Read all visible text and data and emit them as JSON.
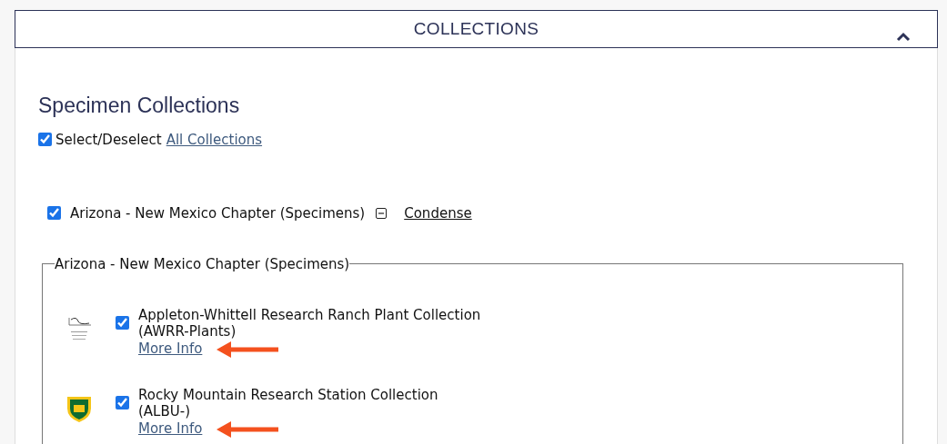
{
  "section": {
    "title": "COLLECTIONS",
    "expanded": true
  },
  "heading": "Specimen Collections",
  "select_all": {
    "checked": true,
    "label": "Select/Deselect",
    "link": "All Collections"
  },
  "chapter": {
    "checked": true,
    "label": "Arizona - New Mexico Chapter (Specimens)",
    "expanded": true,
    "action": "Condense"
  },
  "group": {
    "legend": "Arizona - New Mexico Chapter (Specimens)",
    "collections": [
      {
        "kind": "audubon",
        "checked": true,
        "name": "Appleton-Whittell Research Ranch Plant Collection",
        "code": "(AWRR-Plants)",
        "link": "More Info",
        "annotated": true
      },
      {
        "kind": "shield",
        "checked": true,
        "name": "Rocky Mountain Research Station Collection",
        "code": "(ALBU-)",
        "link": "More Info",
        "annotated": true
      }
    ]
  }
}
